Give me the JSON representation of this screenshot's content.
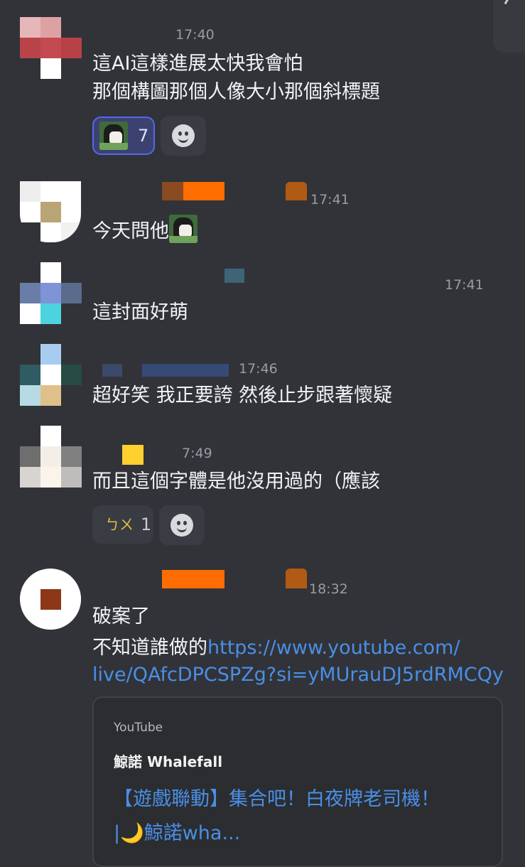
{
  "messages": [
    {
      "time": "17:40",
      "lines": [
        "這AI這樣進展太快我會怕",
        "那個構圖那個人像大小那個斜標題"
      ],
      "reaction_count": "7"
    },
    {
      "time": "17:41",
      "text": "今天問他"
    },
    {
      "time": "17:41",
      "text": "這封面好萌"
    },
    {
      "time": "17:46",
      "text": "超好笑 我正要誇 然後止步跟著懷疑"
    },
    {
      "time": "7:49",
      "text": "而且這個字體是他沒用過的（應該",
      "reaction_count": "1"
    },
    {
      "time": "18:32",
      "line1": "破案了",
      "line2_prefix": "不知道誰做的",
      "link_part1": "https://www.youtube.com/",
      "link_part2": "live/QAfcDPCSPZg?si=yMUrauDJ5rdRMCQy"
    }
  ],
  "embed": {
    "provider": "YouTube",
    "author": "鯨諾 Whalefall",
    "title_line1": "【遊戲聯動】集合吧！白夜牌老司機！",
    "title_line2": "|🌙鯨諾wha..."
  },
  "colors": {
    "background": "#313338",
    "link": "#4a8fe6",
    "timestamp": "#9a9ca3"
  }
}
